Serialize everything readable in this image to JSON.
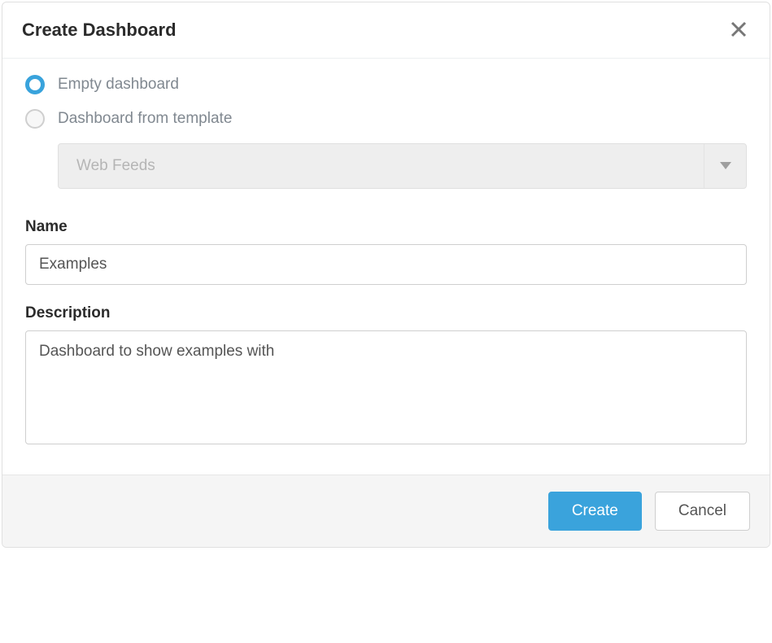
{
  "header": {
    "title": "Create Dashboard"
  },
  "options": {
    "empty": {
      "label": "Empty dashboard",
      "selected": true
    },
    "template": {
      "label": "Dashboard from template",
      "selected": false
    },
    "templateSelect": {
      "value": "Web Feeds"
    }
  },
  "fields": {
    "name": {
      "label": "Name",
      "value": "Examples"
    },
    "description": {
      "label": "Description",
      "value": "Dashboard to show examples with"
    }
  },
  "footer": {
    "primary": "Create",
    "secondary": "Cancel"
  }
}
